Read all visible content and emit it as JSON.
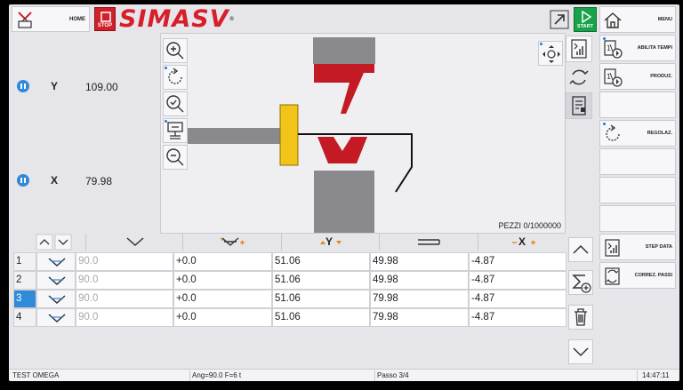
{
  "header": {
    "home_label": "HOME",
    "stop_label": "STOP",
    "logo_text": "SIMASV",
    "logo_mark": "®",
    "start_label": "START",
    "colors": {
      "stop": "#d0202a",
      "start": "#18a34a",
      "logo": "#d81e2a",
      "accent": "#2f89d9"
    }
  },
  "sidebar": {
    "items": [
      {
        "label": "MENU",
        "icon": "home-icon"
      },
      {
        "label": "ABILITA TEMPI",
        "icon": "cycle-time-icon"
      },
      {
        "label": "PRODUZ.",
        "icon": "production-icon"
      },
      {
        "label": "",
        "icon": ""
      },
      {
        "label": "REGOLAZ.",
        "icon": "adjust-rotate-icon"
      },
      {
        "label": "",
        "icon": ""
      },
      {
        "label": "",
        "icon": ""
      },
      {
        "label": "",
        "icon": ""
      },
      {
        "label": "STEP DATA",
        "icon": "step-data-icon"
      },
      {
        "label": "CORREZ. PASSI",
        "icon": "step-correction-icon"
      }
    ]
  },
  "axes": [
    {
      "name": "Y",
      "value": "109.00"
    },
    {
      "name": "X",
      "value": "79.98"
    }
  ],
  "viewport": {
    "pezzi_label": "PEZZI 0/1000000",
    "tools": [
      "zoom-in-icon",
      "rotate-icon",
      "zoom-reset-icon",
      "machine-view-icon",
      "zoom-out-icon"
    ]
  },
  "table": {
    "headers": [
      "angle-header-icon",
      "angle-correction-header-icon",
      "Y",
      "flange-header-icon",
      "X"
    ],
    "rows": [
      {
        "num": "1",
        "ang": "90.0",
        "corr": "+0.0",
        "y": "51.06",
        "flange": "49.98",
        "x": "-4.87"
      },
      {
        "num": "2",
        "ang": "90.0",
        "corr": "+0.0",
        "y": "51.06",
        "flange": "49.98",
        "x": "-4.87"
      },
      {
        "num": "3",
        "ang": "90.0",
        "corr": "+0.0",
        "y": "51.06",
        "flange": "79.98",
        "x": "-4.87"
      },
      {
        "num": "4",
        "ang": "90.0",
        "corr": "+0.0",
        "y": "51.06",
        "flange": "79.98",
        "x": "-4.87"
      }
    ],
    "selected_row": 3
  },
  "status": {
    "program": "TEST OMEGA",
    "angle_force": "Ang=90.0  F=6 t",
    "step": "Passo 3/4",
    "time": "14:47:11"
  }
}
